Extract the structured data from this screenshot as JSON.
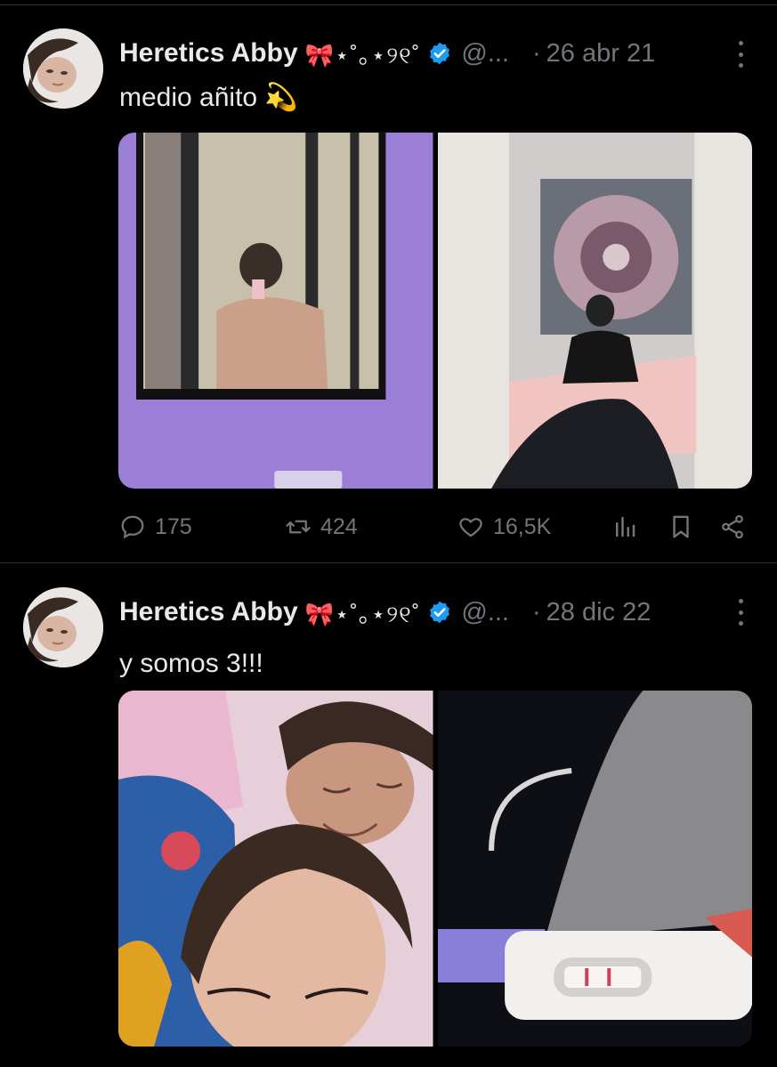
{
  "tweets": [
    {
      "author": {
        "name": "Heretics Abby",
        "decoration": "🎀⋆˚｡⋆୨୧˚",
        "handle": "@..."
      },
      "separator": "·",
      "date": "26 abr 21",
      "text": "medio añito 💫",
      "media": [
        {
          "icon": "mirror-selfie-photo"
        },
        {
          "icon": "bedroom-mirror-photo"
        }
      ],
      "stats": {
        "replies": "175",
        "retweets": "424",
        "likes": "16,5K"
      }
    },
    {
      "author": {
        "name": "Heretics Abby",
        "decoration": "🎀⋆˚｡⋆୨୧˚",
        "handle": "@..."
      },
      "separator": "·",
      "date": "28 dic 22",
      "text": "y somos 3!!!",
      "media": [
        {
          "icon": "couple-selfie-photo"
        },
        {
          "icon": "pregnancy-test-photo"
        }
      ]
    }
  ],
  "colors": {
    "background": "#000000",
    "text": "#e7e9ea",
    "muted": "#71767b",
    "verified": "#1d9bf0",
    "divider": "#2f3336"
  }
}
